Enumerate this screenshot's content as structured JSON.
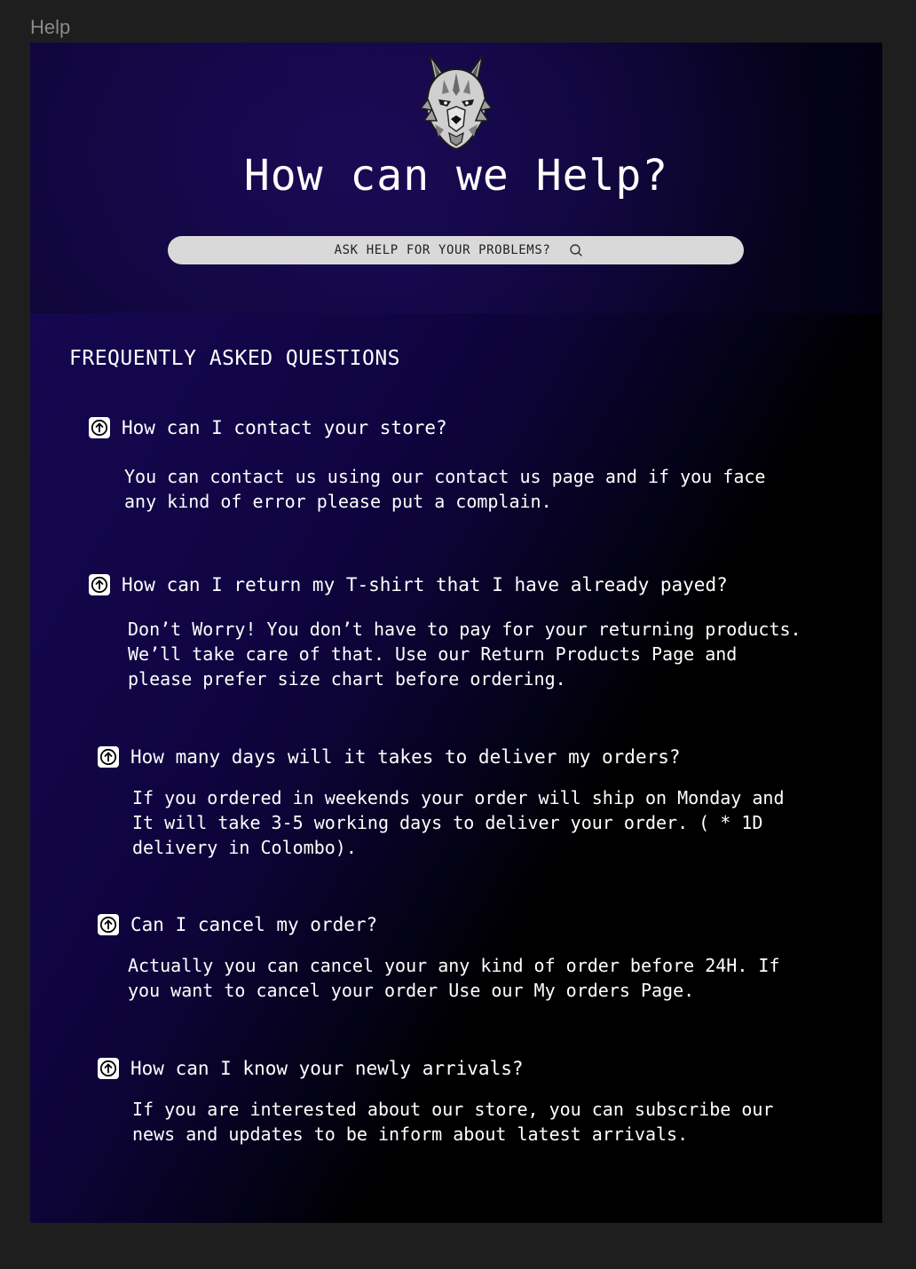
{
  "frame": {
    "label": "Help"
  },
  "hero": {
    "title": "How can we Help?",
    "search_placeholder": "ASK HELP FOR YOUR PROBLEMS?",
    "search_icon": "search-icon",
    "logo_icon": "wolf-logo-icon"
  },
  "faq": {
    "heading": "FREQUENTLY ASKED QUESTIONS",
    "items": [
      {
        "question": "How can I contact your store?",
        "answer": "You can contact us using our contact us page and if you face\nany kind of error please put a complain.",
        "icon": "arrow-up-icon"
      },
      {
        "question": "How can I return my T-shirt that I have already payed?",
        "answer": "Don’t Worry! You don’t have to pay for your returning products.\nWe’ll take care of that. Use our Return Products Page and\nplease prefer size chart before ordering.",
        "icon": "arrow-up-icon"
      },
      {
        "question": "How many days will it takes to deliver my orders?",
        "answer": "If you ordered in weekends your order will ship on Monday and\nIt will take 3-5 working days to deliver your order. ( * 1D\ndelivery in Colombo).",
        "icon": "arrow-up-icon"
      },
      {
        "question": "Can I cancel my order?",
        "answer": "Actually you can cancel your any kind of order before 24H. If\nyou want to cancel your order Use our My orders Page.",
        "icon": "arrow-up-icon"
      },
      {
        "question": "How can I know your newly arrivals?",
        "answer": "If you are interested about our store, you can subscribe our\nnews and updates to be inform about latest arrivals.",
        "icon": "arrow-up-icon"
      }
    ]
  },
  "colors": {
    "hero_bg": "#100640",
    "faq_bg_start": "#150750",
    "faq_bg_end": "#000000",
    "search_bg": "#d9d9d9",
    "text": "#ffffff"
  }
}
